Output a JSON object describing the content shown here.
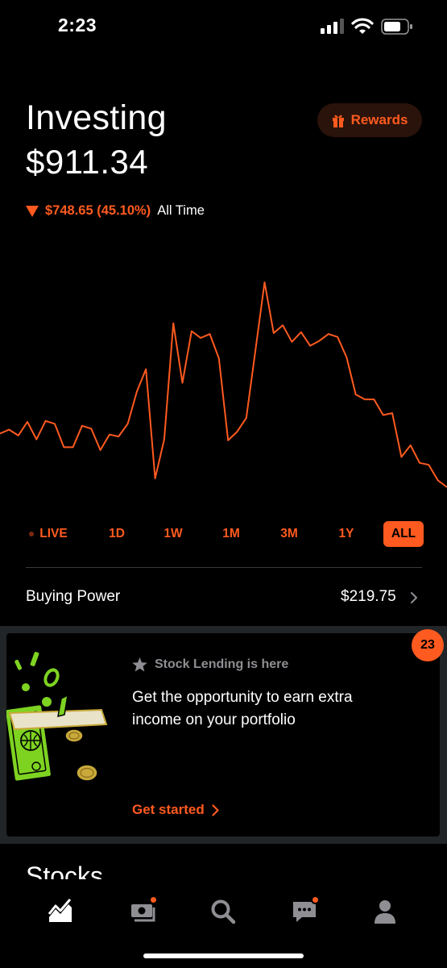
{
  "status_bar": {
    "time": "2:23"
  },
  "header": {
    "title": "Investing",
    "balance": "$911.34",
    "rewards_label": "Rewards",
    "change_amount": "$748.65 (45.10%)",
    "change_period": "All Time"
  },
  "chart": {
    "direction": "down",
    "color": "#ff5a1f",
    "values": [
      488,
      492,
      486,
      500,
      482,
      501,
      498,
      474,
      474,
      496,
      493,
      471,
      487,
      485,
      498,
      531,
      554,
      442,
      482,
      601,
      540,
      593,
      586,
      590,
      565,
      481,
      490,
      504,
      573,
      643,
      591,
      599,
      582,
      592,
      578,
      583,
      590,
      587,
      566,
      528,
      523,
      523,
      507,
      509,
      464,
      476,
      458,
      456,
      440,
      433
    ]
  },
  "range_tabs": {
    "items": [
      {
        "label": "LIVE"
      },
      {
        "label": "1D"
      },
      {
        "label": "1W"
      },
      {
        "label": "1M"
      },
      {
        "label": "3M"
      },
      {
        "label": "1Y"
      },
      {
        "label": "ALL"
      }
    ],
    "active": "ALL"
  },
  "buying_power": {
    "label": "Buying Power",
    "value": "$219.75"
  },
  "promo": {
    "badge_count": "23",
    "kicker": "Stock Lending is here",
    "body": "Get the opportunity to earn extra income on your portfolio",
    "cta": "Get started"
  },
  "stocks_section": {
    "heading": "Stocks"
  },
  "colors": {
    "accent": "#ff5a1f",
    "background": "#000000",
    "muted": "#8e8e93",
    "divider": "#3a3a3a"
  },
  "nav": {
    "items": [
      {
        "icon": "chart-icon",
        "active": true
      },
      {
        "icon": "cash-icon",
        "notification": true
      },
      {
        "icon": "search-icon"
      },
      {
        "icon": "messages-icon",
        "notification": true
      },
      {
        "icon": "account-icon"
      }
    ]
  }
}
